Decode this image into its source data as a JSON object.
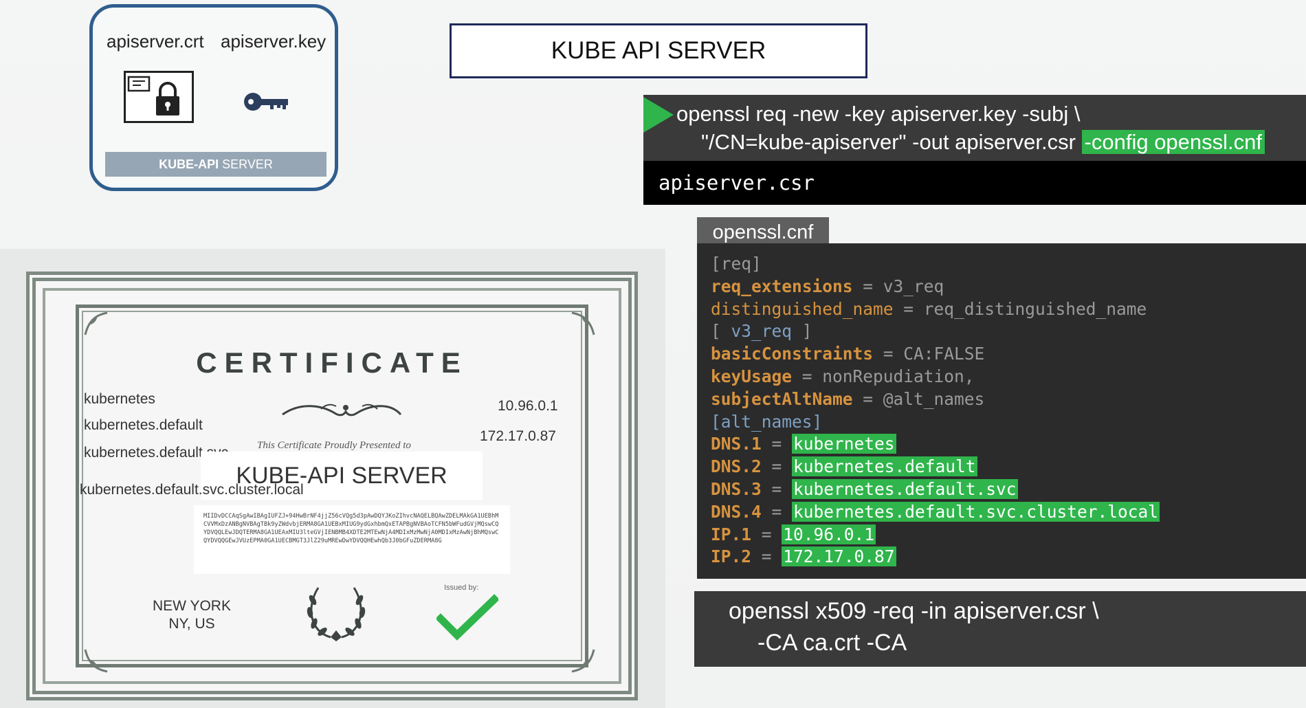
{
  "keypair_card": {
    "cert_file": "apiserver.crt",
    "key_file": "apiserver.key",
    "footer_bold": "KUBE-API",
    "footer_rest": " SERVER"
  },
  "title": "KUBE API SERVER",
  "command1": {
    "line1": "openssl req -new -key apiserver.key -subj \\",
    "line2": "\"/CN=kube-apiserver\" -out apiserver.csr ",
    "line2_highlight": "-config openssl.cnf",
    "output": "apiserver.csr"
  },
  "cnf": {
    "tab": "openssl.cnf",
    "lines": {
      "req_section": "[req]",
      "req_ext_key": "req_extensions",
      "req_ext_val": "v3_req",
      "dn_key": "distinguished_name",
      "dn_val": "req_distinguished_name",
      "v3_section_open": "[ ",
      "v3_section_name": "v3_req",
      "v3_section_close": " ]",
      "bc_key": "basicConstraints",
      "bc_val": "CA:FALSE",
      "ku_key": "keyUsage",
      "ku_val": "nonRepudiation,",
      "san_key": "subjectAltName",
      "san_val": "@alt_names",
      "alt_section": "[alt_names]",
      "dns1_key": "DNS.1",
      "dns1_val": "kubernetes",
      "dns2_key": "DNS.2",
      "dns2_val": "kubernetes.default",
      "dns3_key": "DNS.3",
      "dns3_val": "kubernetes.default.svc",
      "dns4_key": "DNS.4",
      "dns4_val": "kubernetes.default.svc.cluster.local",
      "ip1_key": "IP.1",
      "ip1_val": "10.96.0.1",
      "ip2_key": "IP.2",
      "ip2_val": "172.17.0.87",
      "eq": " = "
    }
  },
  "command2": {
    "line1": "openssl x509 -req -in apiserver.csr \\",
    "line2": "-CA ca.crt -CA"
  },
  "certificate": {
    "heading": "CERTIFICATE",
    "names": [
      "kubernetes",
      "kubernetes.default",
      "kubernetes.default.svc",
      "kubernetes.default.svc.cluster.local"
    ],
    "ips": [
      "10.96.0.1",
      "172.17.0.87"
    ],
    "presented": "This Certificate Proudly Presented to",
    "recipient": "KUBE-API SERVER",
    "blob": "MIIDvDCCAqSgAwIBAgIUFZJ+94HwBrNF4jjZ56cVQg5d3pAwDQYJKoZIhvcNAQELBQAwZDELMAkGA1UEBhMCVVMxDzANBgNVBAgTBk9yZWdvbjERMA8GA1UEBxMIUG9ydGxhbmQxETAPBgNVBAoTCFN5bWFudGVjMQswCQYDVQQLEwJDQTERMA8GA1UEAxMIU3lteGVjIENBMB4XDTE2MTEwNjA4MDIxMzMwNjA0MDIxMzAwNjBhMQswCQYDVQQGEwJVUzEPMA0GA1UECBMGT3JlZ29uMREwDwYDVQQHEwhQb3J0bGFuZDERMA8G",
    "city_line1": "NEW YORK",
    "city_line2": "NY, US",
    "issued_by": "Issued by:"
  },
  "colors": {
    "highlight_green": "#2fb54b",
    "terminal_bg": "#3a3a3a",
    "config_bg": "#2b2b2b",
    "config_key": "#d7933f",
    "card_border": "#2f5e8e"
  },
  "icons": [
    "certificate-lock-icon",
    "key-icon",
    "play-icon",
    "laurel-wreath-icon",
    "checkmark-icon",
    "flourish-ornament-icon"
  ]
}
